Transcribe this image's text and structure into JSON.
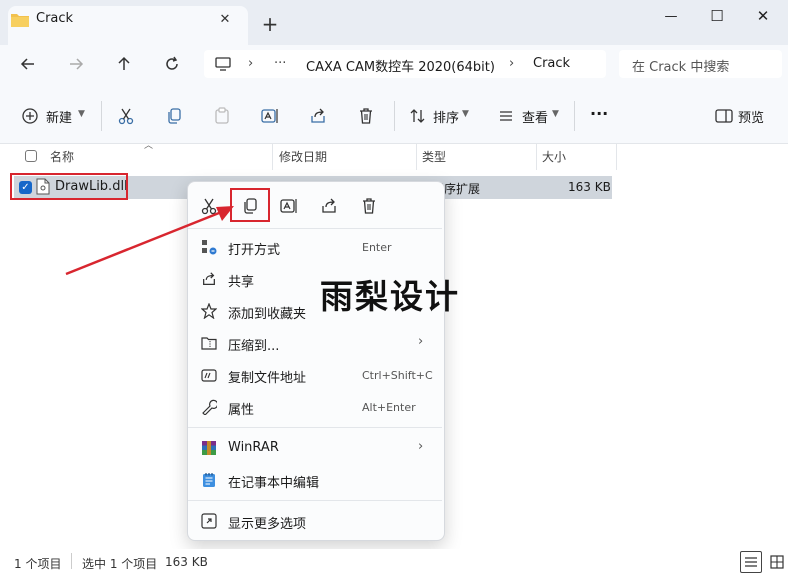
{
  "tab": {
    "title": "Crack",
    "close_glyph": "✕",
    "new_glyph": "+"
  },
  "window": {
    "minimize": "—",
    "maximize": "☐",
    "close": "✕"
  },
  "address": {
    "more": "···",
    "sep": "›",
    "crumbs": [
      "CAXA CAM数控车 2020(64bit)",
      "Crack"
    ],
    "search_placeholder": "在 Crack 中搜索"
  },
  "commands": {
    "new_label": "新建",
    "sort_label": "排序",
    "view_label": "查看",
    "more": "···",
    "preview_label": "预览"
  },
  "columns": {
    "name": "名称",
    "modified": "修改日期",
    "type": "类型",
    "size": "大小"
  },
  "files": [
    {
      "name": "DrawLib.dll",
      "type": "用程序扩展",
      "size": "163 KB",
      "selected": true
    }
  ],
  "context_menu": {
    "items": [
      {
        "label": "打开方式",
        "shortcut": "Enter",
        "icon": "open-with-icon"
      },
      {
        "label": "共享",
        "shortcut": "",
        "icon": "share-icon"
      },
      {
        "label": "添加到收藏夹",
        "shortcut": "",
        "icon": "star-icon"
      },
      {
        "label": "压缩到...",
        "shortcut": "",
        "icon": "zip-folder-icon",
        "submenu": true
      },
      {
        "label": "复制文件地址",
        "shortcut": "Ctrl+Shift+C",
        "icon": "copy-path-icon"
      },
      {
        "label": "属性",
        "shortcut": "Alt+Enter",
        "icon": "wrench-icon"
      },
      {
        "label": "WinRAR",
        "shortcut": "",
        "icon": "winrar-icon",
        "submenu": true
      },
      {
        "label": "在记事本中编辑",
        "shortcut": "",
        "icon": "notepad-icon"
      },
      {
        "label": "显示更多选项",
        "shortcut": "",
        "icon": "more-options-icon"
      }
    ],
    "submenu_glyph": "›"
  },
  "watermark": "雨梨设计",
  "status": {
    "count": "1 个项目",
    "selected": "选中 1 个项目",
    "size": "163 KB"
  },
  "colors": {
    "accent": "#1667c9",
    "highlight": "#d8262f",
    "selection": "#cfd5dc"
  }
}
